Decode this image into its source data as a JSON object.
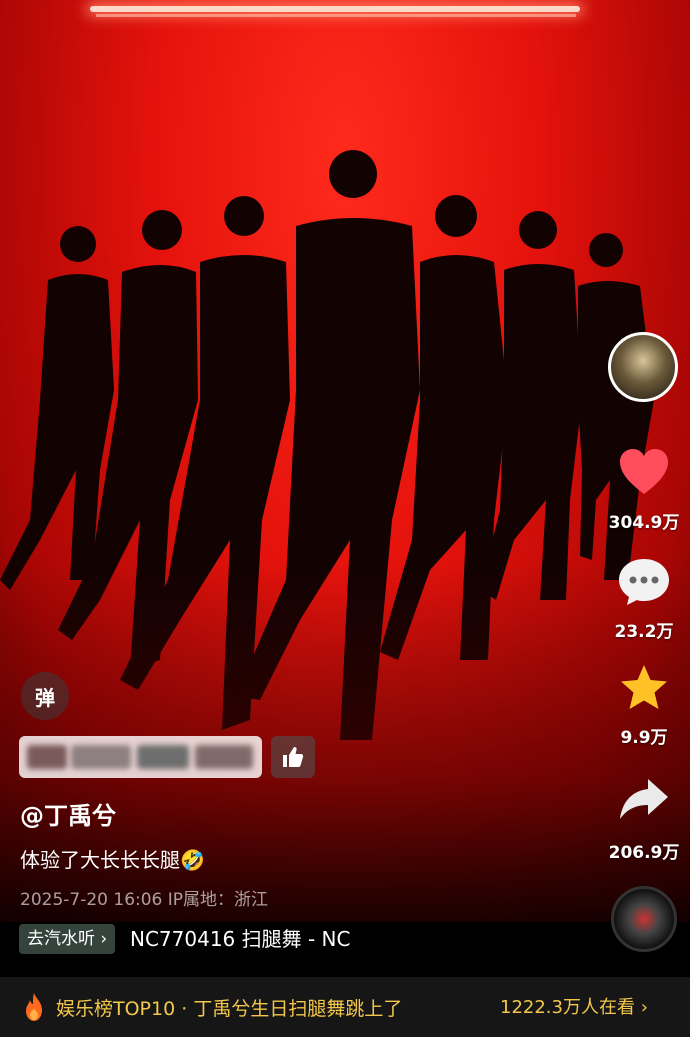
{
  "overlay": {
    "danmu_label": "弹"
  },
  "author": {
    "name": "@丁禹兮"
  },
  "caption": {
    "text": "体验了大长长长腿🤣"
  },
  "meta": {
    "date": "2025-7-20 16:06",
    "ip_location": "IP属地：浙江"
  },
  "actions": {
    "likes": "304.9万",
    "comments": "23.2万",
    "favorites": "9.9万",
    "shares": "206.9万"
  },
  "music": {
    "listen_button": "去汽水听 ›",
    "song_title": "NC770416    扫腿舞 - NC"
  },
  "trending": {
    "text": "娱乐榜TOP10 · 丁禹兮生日扫腿舞跳上了",
    "viewers": "1222.3万人在看 ›"
  },
  "colors": {
    "like_heart": "#ff4d5e",
    "favorite_star": "#ffc226",
    "trend_text": "#f4c84a"
  },
  "icons": [
    "heart-icon",
    "comment-icon",
    "star-icon",
    "share-icon",
    "thumb-up-icon",
    "fire-icon"
  ]
}
